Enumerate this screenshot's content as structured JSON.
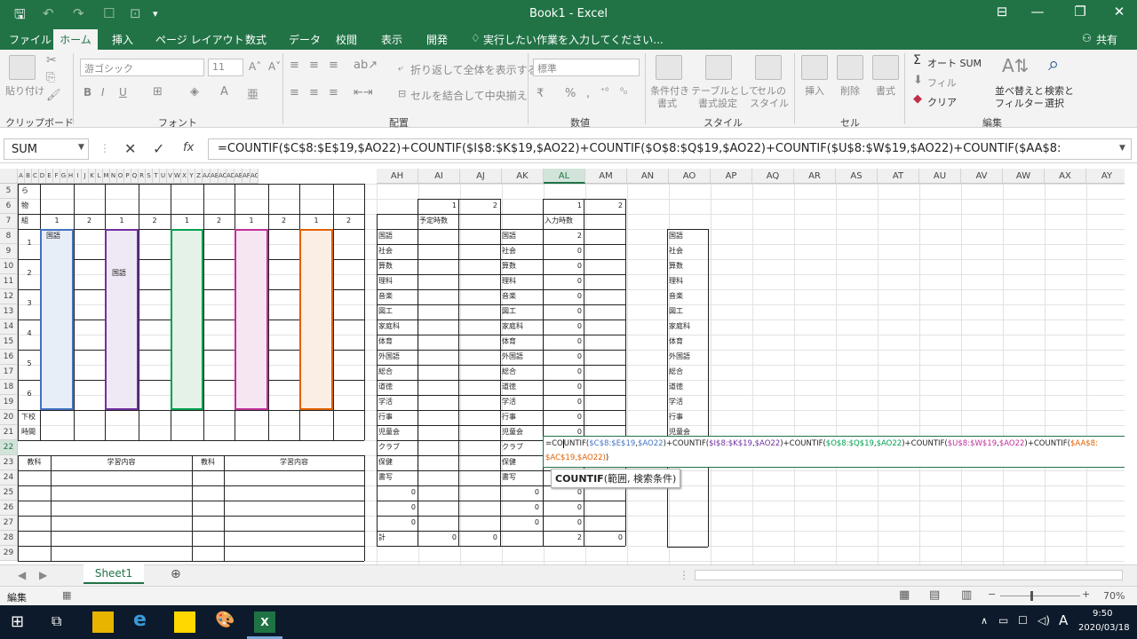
{
  "window": {
    "title": "Book1 - Excel",
    "share": "共有",
    "share_icon": "person-icon"
  },
  "tabs": [
    "ファイル",
    "ホーム",
    "挿入",
    "ページ レイアウト",
    "数式",
    "データ",
    "校閲",
    "表示",
    "開発"
  ],
  "tell_me": "実行したい作業を入力してください...",
  "ribbon": {
    "paste": "貼り付け",
    "font_name": "游ゴシック",
    "font_size": "11",
    "wrap": "折り返して全体を表示する",
    "merge": "セルを結合して中央揃え",
    "num_format": "標準",
    "cond": "条件付き",
    "cond2": "書式",
    "table": "テーブルとして",
    "table2": "書式設定",
    "cell_style": "セルの",
    "cell_style2": "スタイル",
    "insert": "挿入",
    "delete": "削除",
    "format": "書式",
    "autosum": "オート SUM",
    "fill": "フィル",
    "clear": "クリア",
    "sort": "並べ替えと",
    "sort2": "フィルター",
    "find": "検索と",
    "find2": "選択",
    "groups": [
      "クリップボード",
      "フォント",
      "配置",
      "数値",
      "スタイル",
      "セル",
      "編集"
    ]
  },
  "formula_bar": {
    "name_box": "SUM",
    "formula": "=COUNTIF($C$8:$E$19,$AO22)+COUNTIF($I$8:$K$19,$AO22)+COUNTIF($O$8:$Q$19,$AO22)+COUNTIF($U$8:$W$19,$AO22)+COUNTIF($AA$8:"
  },
  "columns_left": [
    "A",
    "B",
    "C",
    "D",
    "E",
    "F",
    "G",
    "H",
    "I",
    "J",
    "K",
    "L",
    "M",
    "N",
    "O",
    "P",
    "Q",
    "R",
    "S",
    "T",
    "U",
    "V",
    "W",
    "X",
    "Y",
    "Z",
    "AA",
    "AB",
    "AC",
    "AD",
    "AE",
    "AF",
    "AG"
  ],
  "columns_right": [
    "AH",
    "AI",
    "AJ",
    "AK",
    "AL",
    "AM",
    "AN",
    "AO",
    "AP",
    "AQ",
    "AR",
    "AS",
    "AT",
    "AU",
    "AV",
    "AW",
    "AX",
    "AY"
  ],
  "rows": [
    "5",
    "6",
    "7",
    "8",
    "9",
    "10",
    "11",
    "12",
    "13",
    "14",
    "15",
    "16",
    "17",
    "18",
    "19",
    "20",
    "21",
    "22",
    "23",
    "24",
    "25",
    "26",
    "27",
    "28",
    "29"
  ],
  "left_table": {
    "r5": "ら",
    "r6": "物",
    "r7": "組",
    "class_nums": [
      "1",
      "2",
      "1",
      "2",
      "1",
      "2",
      "1",
      "2",
      "1",
      "2"
    ],
    "periods": [
      "1",
      "2",
      "3",
      "4",
      "5",
      "6"
    ],
    "kokugo1": "国語",
    "kokugo2": "国語",
    "dismissal1": "下校",
    "dismissal2": "時間",
    "subject_hdr": "教科",
    "content_hdr": "学習内容"
  },
  "subjects": [
    "国語",
    "社会",
    "算数",
    "理科",
    "音楽",
    "図工",
    "家庭科",
    "体育",
    "外国語",
    "総合",
    "道徳",
    "学活",
    "行事",
    "児童会",
    "クラブ",
    "保健",
    "書写"
  ],
  "scheduled": {
    "top": [
      "1",
      "2"
    ],
    "label": "予定時数",
    "zeros": [
      "0",
      "0",
      "0"
    ],
    "total_label": "計",
    "totals": [
      "0",
      "0"
    ]
  },
  "entered": {
    "top": [
      "1",
      "2"
    ],
    "label": "入力時数",
    "values": [
      "2",
      "0",
      "0",
      "0",
      "0",
      "0",
      "0",
      "0",
      "0",
      "0",
      "0",
      "0",
      "0",
      "0"
    ],
    "zeros": [
      "0",
      "0",
      "0"
    ],
    "totals": [
      "2",
      "0"
    ]
  },
  "mid_zeros": [
    "0",
    "0",
    "0"
  ],
  "edit_formula": {
    "f1": "=CO",
    "f1b": "UNTIF(",
    "r1": "$C$8:$E$19",
    "p": ",",
    "a1": "$AO22",
    "plus": ")+COUNTIF(",
    "r2": "$I$8:$K$19",
    "r3": "$O$8:$Q$19",
    "r4": "$U$8:$W$19",
    "r5": "$AA$8:",
    "line2": "$AC$19,$AO22)",
    "close": ")"
  },
  "tooltip": {
    "fn": "COUNTIF",
    "args": "(範囲, 検索条件)"
  },
  "sheet_tab": "Sheet1",
  "status": {
    "mode": "編集",
    "zoom": "70%"
  },
  "taskbar": {
    "time": "9:50",
    "date": "2020/03/18",
    "ime": "A"
  },
  "colors": {
    "blue": "#4472c4",
    "purple": "#7030a0",
    "green": "#00a050",
    "magenta": "#c0309a",
    "orange": "#e06000",
    "excel": "#217346"
  }
}
